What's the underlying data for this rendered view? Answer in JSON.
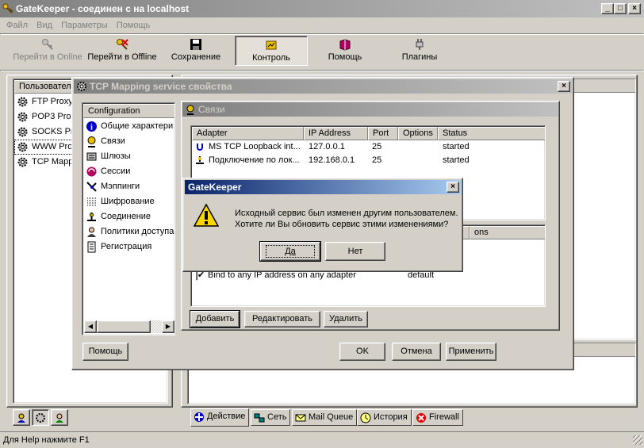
{
  "main_window": {
    "title": "GateKeeper - соединен с на localhost",
    "controls": {
      "minimize": "_",
      "maximize": "□",
      "close": "×"
    }
  },
  "menu": [
    "Файл",
    "Вид",
    "Параметры",
    "Помощь"
  ],
  "toolbar": [
    {
      "label": "Перейти в Online",
      "icon": "key-icon",
      "disabled": true
    },
    {
      "label": "Перейти в Offline",
      "icon": "key-cross-icon",
      "disabled": false
    },
    {
      "label": "Сохранение",
      "icon": "floppy-icon",
      "disabled": false
    },
    {
      "label": "Контроль",
      "icon": "control-icon",
      "disabled": false,
      "pressed": true
    },
    {
      "label": "Помощь",
      "icon": "help-book-icon",
      "disabled": false
    },
    {
      "label": "Плагины",
      "icon": "plug-icon",
      "disabled": false
    }
  ],
  "left_panel": {
    "header": "Пользовател",
    "items": [
      "FTP Proxy",
      "POP3 Proxy",
      "SOCKS Proxy",
      "WWW Proxy",
      "TCP Mapping"
    ]
  },
  "bottom_tabs": [
    "Действие",
    "Сеть",
    "Mail Queue",
    "История",
    "Firewall"
  ],
  "status_bar": "Для Help нажмите F1",
  "props_dialog": {
    "title": "TCP Mapping service свойства",
    "tree_header": "Configuration",
    "tree_items": [
      {
        "label": "Общие характери",
        "icon": "info-icon"
      },
      {
        "label": "Связи",
        "icon": "binding-icon"
      },
      {
        "label": "Шлюзы",
        "icon": "gateway-icon"
      },
      {
        "label": "Сессии",
        "icon": "sessions-icon"
      },
      {
        "label": "Мэппинги",
        "icon": "mapping-icon"
      },
      {
        "label": "Шифрование",
        "icon": "encryption-icon"
      },
      {
        "label": "Соединение",
        "icon": "connection-icon"
      },
      {
        "label": "Политики доступа",
        "icon": "policy-icon"
      },
      {
        "label": "Регистрация",
        "icon": "log-icon"
      }
    ],
    "section_title": "Связи",
    "columns": [
      "Adapter",
      "IP Address",
      "Port",
      "Options",
      "Status"
    ],
    "rows": [
      {
        "adapter": "MS TCP Loopback int...",
        "ip": "127.0.0.1",
        "port": "25",
        "options": "",
        "status": "started"
      },
      {
        "adapter": "Подключение по лок...",
        "ip": "192.168.0.1",
        "port": "25",
        "options": "",
        "status": "started"
      }
    ],
    "lower_header_fragment": "ons",
    "bind_label": "Bind to any IP address on any adapter",
    "bind_value": "default",
    "bind_checked": "✔",
    "buttons": {
      "add": "Добавить",
      "edit": "Редактировать",
      "delete": "Удалить"
    },
    "footer": {
      "help": "Помощь",
      "ok": "OK",
      "cancel": "Отмена",
      "apply": "Применить"
    }
  },
  "message_box": {
    "title": "GateKeeper",
    "line1": "Исходный сервис был изменен другим пользователем.",
    "line2": "Хотите ли Вы обновить сервис этими изменениями?",
    "yes": "Да",
    "no": "Нет"
  },
  "colors": {
    "face": "#d4d0c8",
    "title_active": "#0a246a",
    "title_active_end": "#a6caf0",
    "title_inactive": "#808080",
    "warning": "#ffd700"
  }
}
